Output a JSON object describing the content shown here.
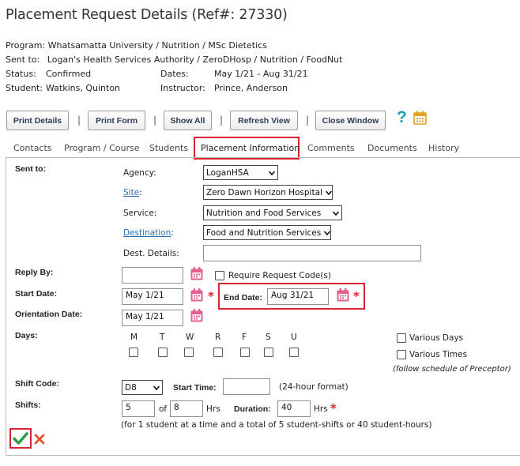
{
  "page": {
    "title": "Placement Request Details (Ref#: 27330)"
  },
  "summary": {
    "program_label": "Program:",
    "program_value": "Whatsamatta University / Nutrition / MSc Dietetics",
    "sentto_label": "Sent to:",
    "sentto_value": "Logan's Health Services Authority / ZeroDHosp / Nutrition / FoodNut",
    "status_label": "Status:",
    "status_value": "Confirmed",
    "dates_label": "Dates:",
    "dates_value": "May 1/21 - Aug 31/21",
    "student_label": "Student:",
    "student_value": "Watkins, Quinton",
    "instructor_label": "Instructor:",
    "instructor_value": "Prince, Anderson"
  },
  "toolbar": {
    "print_details": "Print Details",
    "print_form": "Print Form",
    "show_all": "Show All",
    "refresh_view": "Refresh View",
    "close_window": "Close Window",
    "separator": "|",
    "help_icon": "question-mark-icon",
    "calendar_icon": "calendar-icon"
  },
  "tabs": [
    {
      "label": "Contacts"
    },
    {
      "label": "Program / Course"
    },
    {
      "label": "Students"
    },
    {
      "label": "Placement Information",
      "active": true
    },
    {
      "label": "Comments"
    },
    {
      "label": "Documents"
    },
    {
      "label": "History"
    }
  ],
  "form": {
    "sent_to_label": "Sent to:",
    "agency_label": "Agency:",
    "agency_value": "LoganHSA",
    "site_label": "Site",
    "site_colon": ":",
    "site_value": "Zero Dawn Horizon Hospital",
    "service_label": "Service:",
    "service_value": "Nutrition and Food Services",
    "destination_label": "Destination",
    "destination_colon": ":",
    "destination_value": "Food and Nutrition Services",
    "dest_details_label": "Dest. Details:",
    "dest_details_value": "",
    "reply_by_label": "Reply By:",
    "reply_by_value": "",
    "require_code_label": "Require Request Code(s)",
    "start_date_label": "Start Date:",
    "start_date_value": "May 1/21",
    "end_date_label": "End Date:",
    "end_date_value": "Aug 31/21",
    "orientation_label": "Orientation Date:",
    "orientation_value": "May 1/21",
    "days_label": "Days:",
    "days": [
      "M",
      "T",
      "W",
      "R",
      "F",
      "S",
      "U"
    ],
    "various_days_label": "Various Days",
    "various_times_label": "Various Times",
    "follow_schedule_note": "(follow schedule of Preceptor)",
    "shift_code_label": "Shift Code:",
    "shift_code_value": "D8",
    "start_time_label": "Start Time:",
    "start_time_value": "",
    "hour_format_note": "(24-hour format)",
    "shifts_label": "Shifts:",
    "shifts_value": "5",
    "of_label": "of",
    "shifts_total_value": "8",
    "hrs_label": "Hrs",
    "duration_label": "Duration:",
    "duration_value": "40",
    "hrs_label_2": "Hrs",
    "shifts_note": "(for 1 student at a time and a total of 5 student-shifts or 40 student-hours)",
    "required_marker": "*"
  },
  "actions": {
    "save_icon": "checkmark-icon",
    "cancel_icon": "x-icon"
  },
  "colors": {
    "accent_red": "#d9232e",
    "link_blue": "#2a6fb5",
    "calendar_pink": "#e5608f",
    "save_green": "#2e9b43",
    "cancel_orange": "#e8542a",
    "help_teal": "#1aa3b5"
  }
}
